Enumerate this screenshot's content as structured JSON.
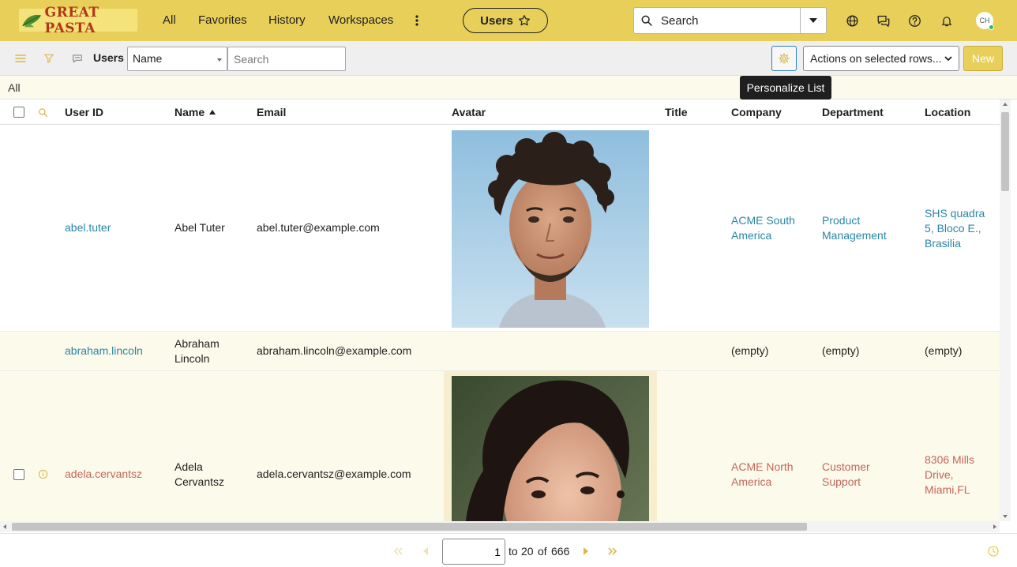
{
  "topnav": {
    "brand": "GREAT PASTA",
    "links": [
      "All",
      "Favorites",
      "History",
      "Workspaces"
    ],
    "more_icon": "more-vertical-icon",
    "context_pill": "Users",
    "search_placeholder": "Search",
    "avatar_initials": "CH",
    "icons": [
      "globe-icon",
      "chat-icon",
      "help-icon",
      "bell-icon"
    ],
    "colors": {
      "bar": "#e7cf5a",
      "brand_text": "#b2361a"
    }
  },
  "listbar": {
    "title": "Users",
    "field_select": "Name",
    "search_placeholder": "Search",
    "actions_select": "Actions on selected rows...",
    "new_button": "New",
    "tooltip": "Personalize List"
  },
  "breadcrumb": "All",
  "table": {
    "columns": [
      "User ID",
      "Name",
      "Email",
      "Avatar",
      "Title",
      "Company",
      "Department",
      "Location"
    ],
    "sorted_column": "Name",
    "rows": [
      {
        "user_id": "abel.tuter",
        "name": "Abel Tuter",
        "email": "abel.tuter@example.com",
        "title": "",
        "company": "ACME South America",
        "department": "Product Management",
        "location": "SHS quadra 5, Bloco E., Brasilia"
      },
      {
        "user_id": "abraham.lincoln",
        "name": "Abraham Lincoln",
        "email": "abraham.lincoln@example.com",
        "title": "",
        "company": "(empty)",
        "department": "(empty)",
        "location": "(empty)"
      },
      {
        "user_id": "adela.cervantsz",
        "name": "Adela Cervantsz",
        "email": "adela.cervantsz@example.com",
        "title": "",
        "company": "ACME North America",
        "department": "Customer Support",
        "location": "8306 Mills Drive, Miami,FL"
      }
    ]
  },
  "pagination": {
    "current_page": "1",
    "to_text": "to",
    "range_end": "20",
    "of_text": "of",
    "total": "666"
  }
}
